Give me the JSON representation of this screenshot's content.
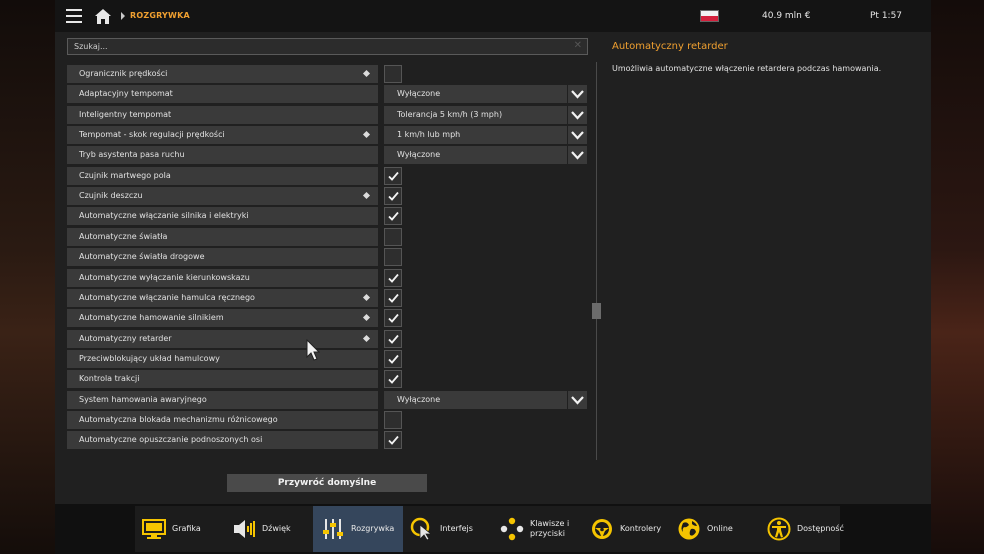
{
  "topbar": {
    "breadcrumb": "ROZGRYWKA",
    "money": "40.9 mln €",
    "clock": "Pt 1:57"
  },
  "search": {
    "placeholder": "Szukaj..."
  },
  "settings": [
    {
      "label": "Ogranicznik prędkości",
      "dot": true,
      "control": "checkbox",
      "checked": false
    },
    {
      "label": "Adaptacyjny tempomat",
      "dot": false,
      "control": "dropdown",
      "value": "Wyłączone"
    },
    {
      "label": "Inteligentny tempomat",
      "dot": false,
      "control": "dropdown",
      "value": "Tolerancja 5 km/h (3 mph)"
    },
    {
      "label": "Tempomat - skok regulacji prędkości",
      "dot": true,
      "control": "dropdown",
      "value": "1 km/h lub mph"
    },
    {
      "label": "Tryb asystenta pasa ruchu",
      "dot": false,
      "control": "dropdown",
      "value": "Wyłączone"
    },
    {
      "label": "Czujnik martwego pola",
      "dot": false,
      "control": "checkbox",
      "checked": true
    },
    {
      "label": "Czujnik deszczu",
      "dot": true,
      "control": "checkbox",
      "checked": true
    },
    {
      "label": "Automatyczne włączanie silnika i elektryki",
      "dot": false,
      "control": "checkbox",
      "checked": true
    },
    {
      "label": "Automatyczne światła",
      "dot": false,
      "control": "checkbox",
      "checked": false
    },
    {
      "label": "Automatyczne światła drogowe",
      "dot": false,
      "control": "checkbox",
      "checked": false
    },
    {
      "label": "Automatyczne wyłączanie kierunkowskazu",
      "dot": false,
      "control": "checkbox",
      "checked": true
    },
    {
      "label": "Automatyczne włączanie hamulca ręcznego",
      "dot": true,
      "control": "checkbox",
      "checked": true
    },
    {
      "label": "Automatyczne hamowanie silnikiem",
      "dot": true,
      "control": "checkbox",
      "checked": true
    },
    {
      "label": "Automatyczny retarder",
      "dot": true,
      "control": "checkbox",
      "checked": true
    },
    {
      "label": "Przeciwblokujący układ hamulcowy",
      "dot": false,
      "control": "checkbox",
      "checked": true
    },
    {
      "label": "Kontrola trakcji",
      "dot": false,
      "control": "checkbox",
      "checked": true
    },
    {
      "label": "System hamowania awaryjnego",
      "dot": false,
      "control": "dropdown",
      "value": "Wyłączone"
    },
    {
      "label": "Automatyczna blokada mechanizmu różnicowego",
      "dot": false,
      "control": "checkbox",
      "checked": false
    },
    {
      "label": "Automatyczne opuszczanie podnoszonych osi",
      "dot": false,
      "control": "checkbox",
      "checked": true
    }
  ],
  "description": {
    "title": "Automatyczny retarder",
    "text": "Umożliwia automatyczne włączenie retardera podczas hamowania."
  },
  "reset_button": "Przywróć domyślne",
  "tabs": [
    {
      "id": "grafika",
      "label": "Grafika",
      "icon": "monitor-icon",
      "active": false
    },
    {
      "id": "dzwiek",
      "label": "Dźwięk",
      "icon": "speaker-icon",
      "active": false
    },
    {
      "id": "rozgrywka",
      "label": "Rozgrywka",
      "icon": "sliders-icon",
      "active": true
    },
    {
      "id": "interfejs",
      "label": "Interfejs",
      "icon": "pointer-icon",
      "active": false
    },
    {
      "id": "klawisze",
      "label": "Klawisze i\nprzyciski",
      "icon": "gamepad-buttons-icon",
      "active": false
    },
    {
      "id": "kontrolery",
      "label": "Kontrolery",
      "icon": "steering-wheel-icon",
      "active": false
    },
    {
      "id": "online",
      "label": "Online",
      "icon": "globe-icon",
      "active": false
    },
    {
      "id": "dostepnosc",
      "label": "Dostępność",
      "icon": "accessibility-icon",
      "active": false
    }
  ],
  "colors": {
    "accent": "#f0a030",
    "active_tab": "#35465c",
    "icon_yellow": "#f5c400"
  }
}
